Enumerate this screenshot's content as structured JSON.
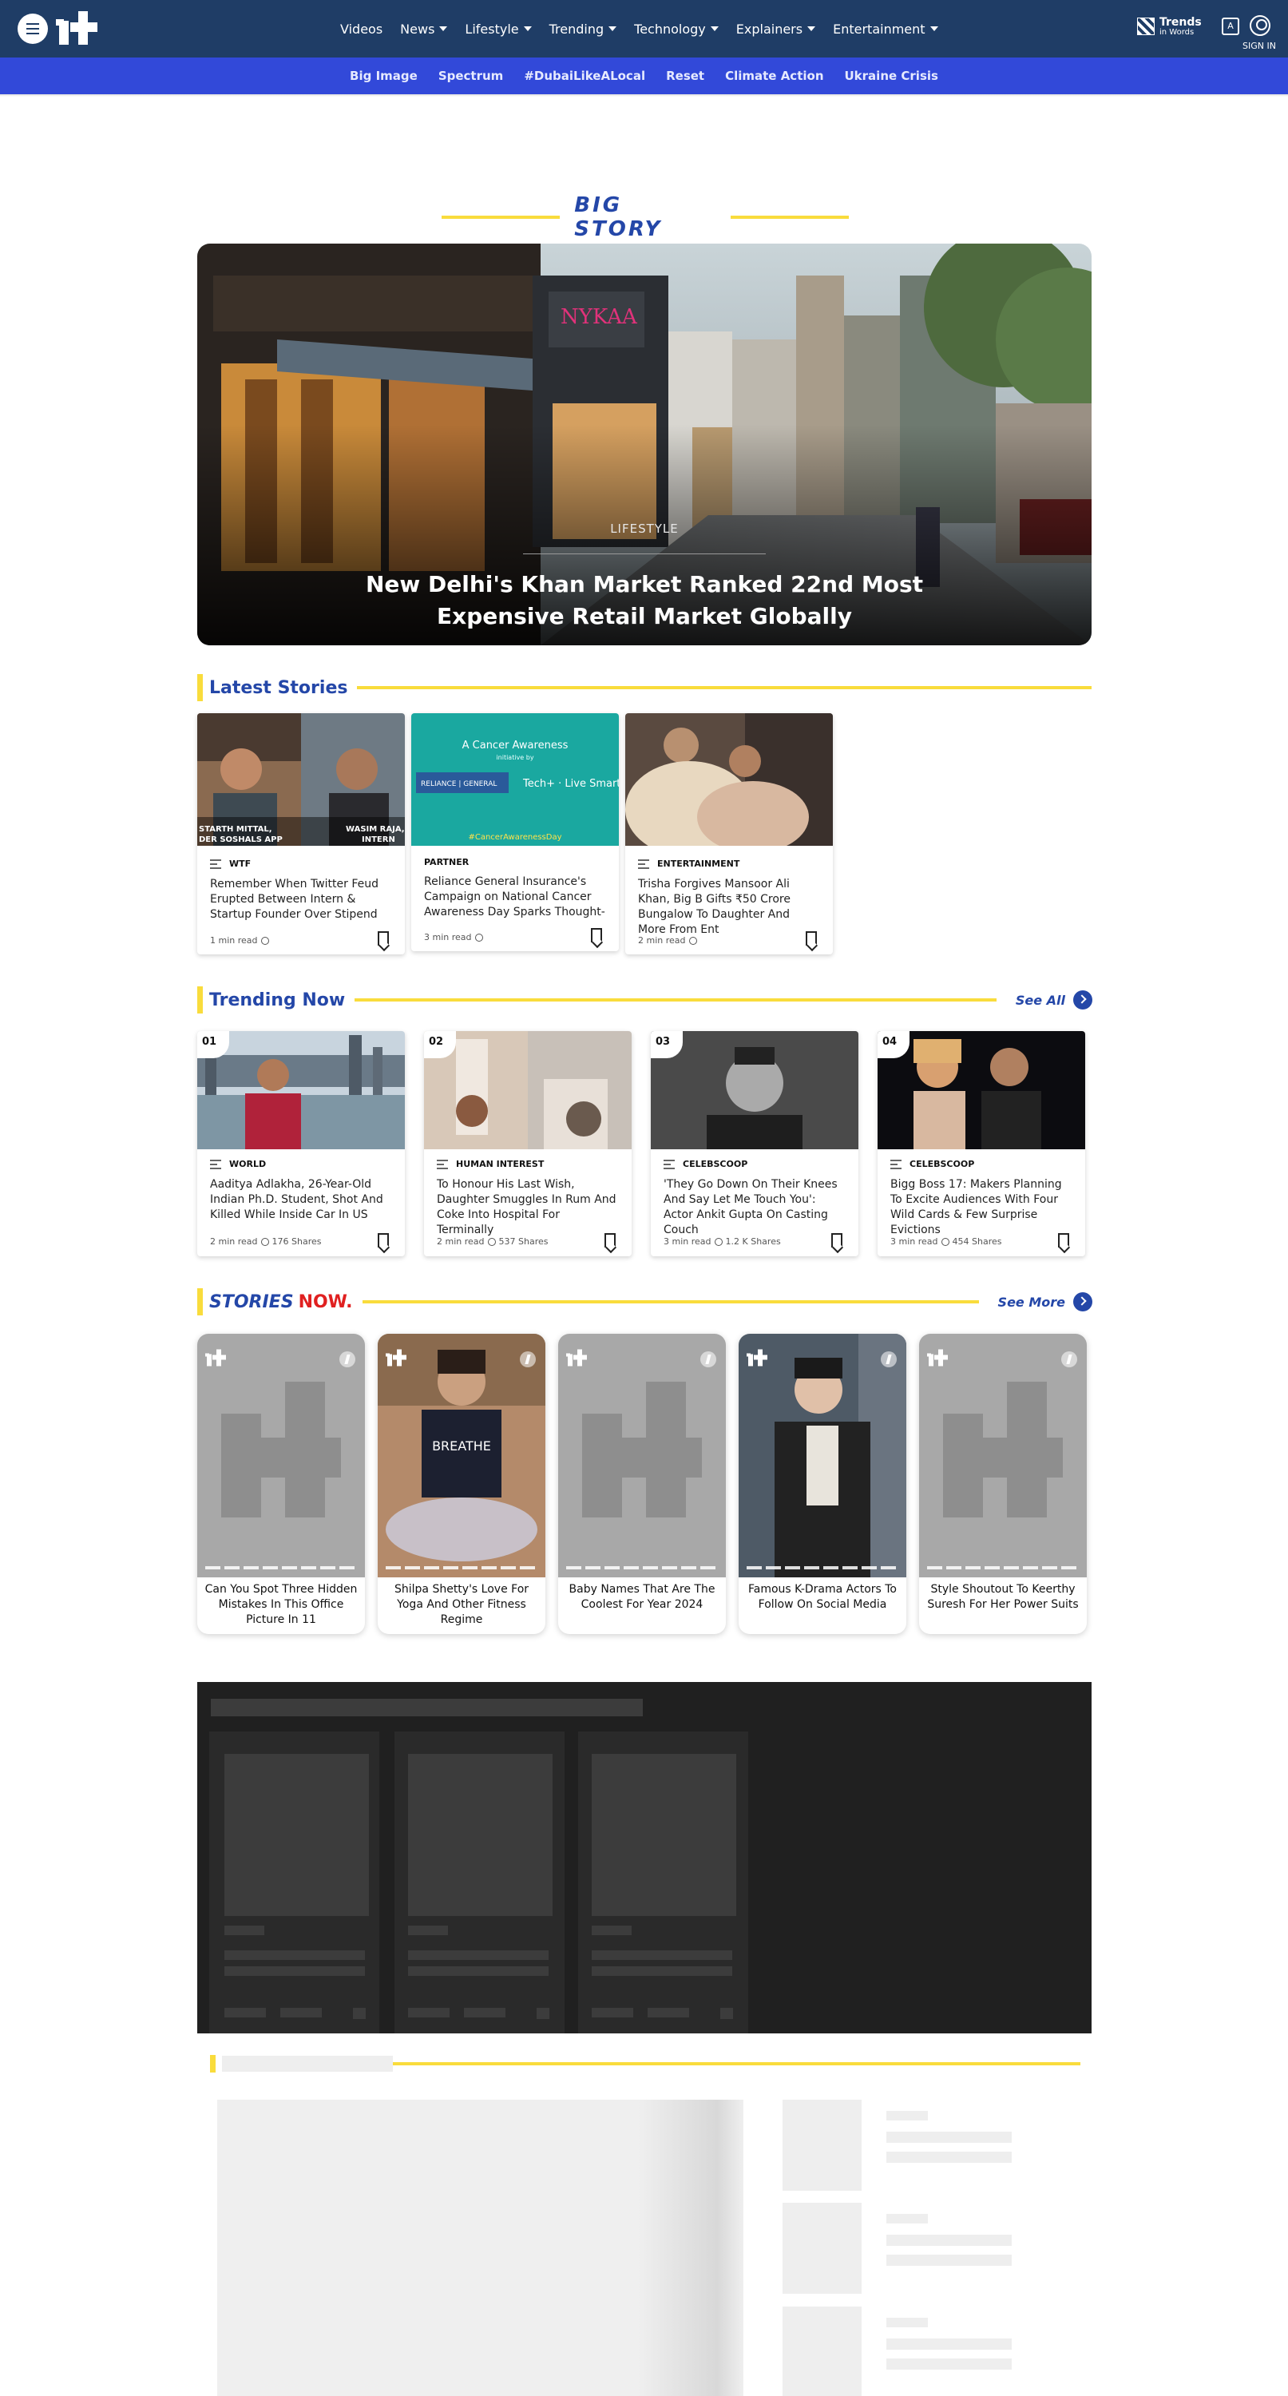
{
  "header": {
    "nav": [
      "Videos",
      "News",
      "Lifestyle",
      "Trending",
      "Technology",
      "Explainers",
      "Entertainment"
    ],
    "nav_has_caret": [
      false,
      true,
      true,
      true,
      true,
      true,
      true
    ],
    "trends_line1": "Trends",
    "trends_line2": "in Words",
    "lang_glyph": "A",
    "signin": "SIGN IN"
  },
  "subnav": [
    "Big Image",
    "Spectrum",
    "#DubaiLikeALocal",
    "Reset",
    "Climate Action",
    "Ukraine Crisis"
  ],
  "big_story": {
    "heading": "BIG STORY",
    "category": "LIFESTYLE",
    "title_line1": "New Delhi's Khan Market Ranked 22nd Most",
    "title_line2": "Expensive Retail Market Globally"
  },
  "latest": {
    "heading": "Latest Stories",
    "cards": [
      {
        "category": "WTF",
        "title": "Remember When Twitter Feud Erupted Between Intern & Startup Founder Over Stipend",
        "meta": "1 min read",
        "img_text_left": "STARTH MITTAL,\nDER SOSHALS APP",
        "img_text_right": "WASIM RAJA,\nINTERN"
      },
      {
        "category": "PARTNER",
        "title": "Reliance General Insurance's Campaign on National Cancer Awareness Day Sparks Thought-",
        "meta": "3 min read",
        "img_text_top": "A Cancer Awareness",
        "img_text_sub": "initiative by",
        "img_text_brand": "Tech+ Live Smart",
        "img_text_tag": "#CancerAwarenessDay",
        "img_text_logo": "RELIANCE GENERAL INSURANCE"
      },
      {
        "category": "ENTERTAINMENT",
        "title": "Trisha Forgives Mansoor Ali Khan, Big B Gifts ₹50 Crore Bungalow To Daughter And More From Ent",
        "meta": "2 min read"
      }
    ]
  },
  "trending": {
    "heading": "Trending Now",
    "see_all": "See All",
    "cards": [
      {
        "num": "01",
        "category": "WORLD",
        "title": "Aaditya Adlakha, 26-Year-Old Indian Ph.D. Student, Shot And Killed While Inside Car In US",
        "read": "2 min read",
        "shares": "176 Shares"
      },
      {
        "num": "02",
        "category": "HUMAN INTEREST",
        "title": "To Honour His Last Wish, Daughter Smuggles In Rum And Coke Into Hospital For Terminally",
        "read": "2 min read",
        "shares": "537 Shares"
      },
      {
        "num": "03",
        "category": "CELEBSCOOP",
        "title": "'They Go Down On Their Knees And Say Let Me Touch You': Actor Ankit Gupta On Casting Couch",
        "read": "3 min read",
        "shares": "1.2 K Shares"
      },
      {
        "num": "04",
        "category": "CELEBSCOOP",
        "title": "Bigg Boss 17: Makers Planning To Excite Audiences With Four Wild Cards & Few Surprise Evictions",
        "read": "3 min read",
        "shares": "454 Shares"
      }
    ]
  },
  "stories": {
    "heading_a": "STORIES",
    "heading_b": "NOW.",
    "see_more": "See More",
    "items": [
      {
        "title": "Can You Spot Three Hidden Mistakes In This Office Picture In 11"
      },
      {
        "title": "Shilpa Shetty's Love For Yoga And Other Fitness Regime",
        "img_text": "BREATHE"
      },
      {
        "title": "Baby Names That Are The Coolest For Year 2024"
      },
      {
        "title": "Famous K-Drama Actors To Follow On Social Media"
      },
      {
        "title": "Style Shoutout To Keerthy Suresh For Her Power Suits"
      }
    ]
  },
  "colors": {
    "nav_bg": "#1f3d66",
    "subnav_bg": "#3249d9",
    "accent_blue": "#2447a8",
    "accent_yellow": "#f9dc3c",
    "accent_red": "#e02020"
  },
  "icons": [
    "menu-icon",
    "logo-icon",
    "trends-in-words-icon",
    "language-icon",
    "user-icon",
    "caret-down-icon",
    "clock-icon",
    "bookmark-icon",
    "chevron-right-icon",
    "lines-icon",
    "bolt-icon"
  ]
}
